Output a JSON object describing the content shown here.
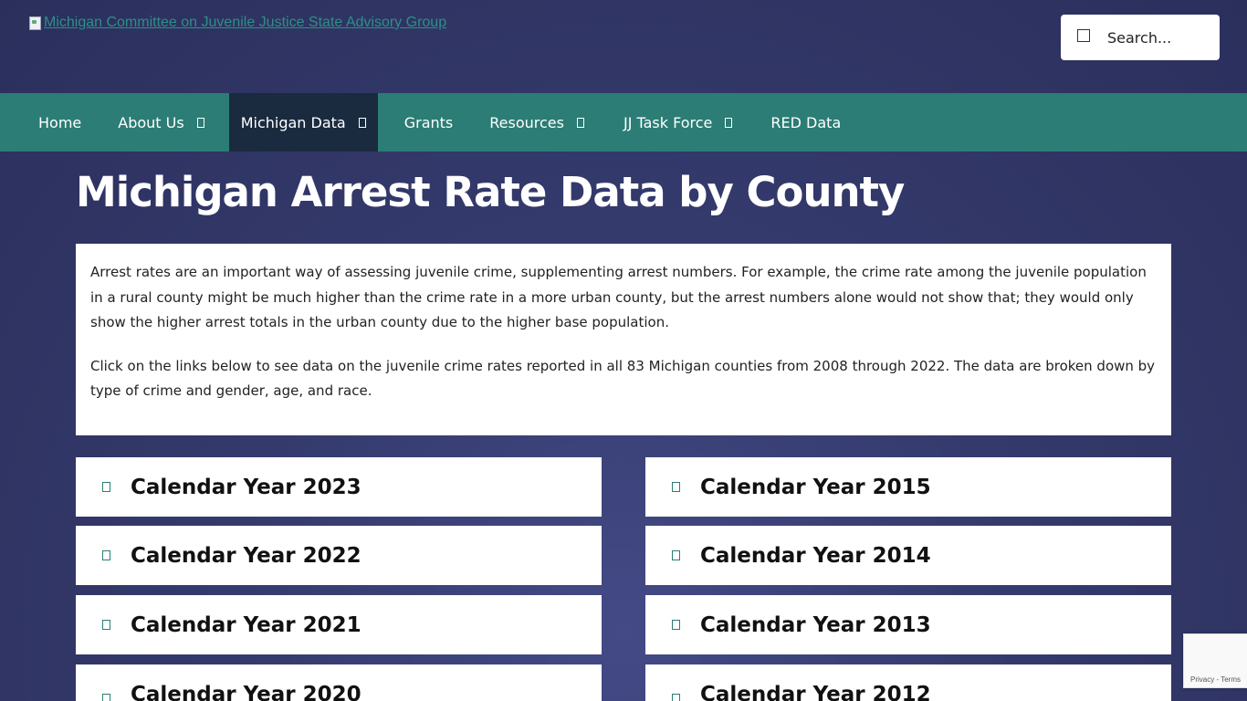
{
  "header": {
    "logo_alt": "Michigan Committee on Juvenile Justice State Advisory Group",
    "search_placeholder": "Search..."
  },
  "nav": {
    "items": [
      {
        "label": "Home",
        "has_dropdown": false
      },
      {
        "label": "About Us",
        "has_dropdown": true
      },
      {
        "label": "Michigan Data",
        "has_dropdown": true,
        "active": true
      },
      {
        "label": "Grants",
        "has_dropdown": false
      },
      {
        "label": "Resources",
        "has_dropdown": true
      },
      {
        "label": "JJ Task Force",
        "has_dropdown": true
      },
      {
        "label": "RED Data",
        "has_dropdown": false
      }
    ]
  },
  "page": {
    "title": "Michigan Arrest Rate Data by County",
    "intro_p1": "Arrest rates are an important way of assessing juvenile crime, supplementing arrest numbers. For example, the crime rate among the juvenile population in a rural county might be much higher than the crime rate in a more urban county, but the arrest numbers alone would not show that; they would only show the higher arrest totals in the urban county due to the higher base population.",
    "intro_p2": "Click on the links below to see data on the juvenile crime rates reported in all 83 Michigan counties from 2008 through 2022. The data are broken down by type of crime and gender, age, and race."
  },
  "years_left": [
    "Calendar Year 2023",
    "Calendar Year 2022",
    "Calendar Year 2021",
    "Calendar Year 2020"
  ],
  "years_right": [
    "Calendar Year 2015",
    "Calendar Year 2014",
    "Calendar Year 2013",
    "Calendar Year 2012"
  ],
  "recaptcha": {
    "text": "Privacy - Terms"
  },
  "colors": {
    "nav_bg": "#2b7d75",
    "nav_active_bg": "#1a2b3f",
    "page_bg": "#343a6c",
    "link": "#2d8f86"
  }
}
